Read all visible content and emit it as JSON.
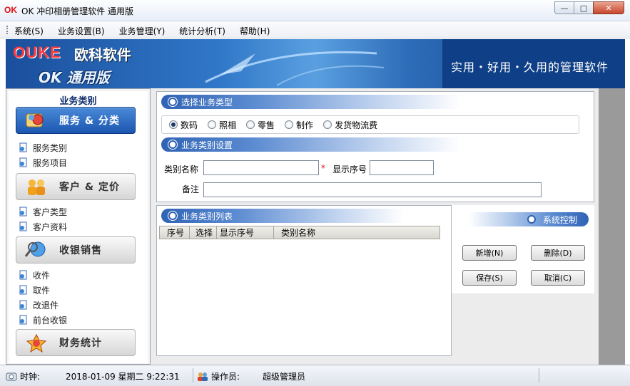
{
  "window": {
    "logo_text": "OK",
    "title": "OK 冲印相册管理软件 通用版",
    "controls": {
      "minimize": "—",
      "maximize": "□",
      "close": "✕"
    }
  },
  "menu": {
    "items": [
      {
        "label": "系统(S)"
      },
      {
        "label": "业务设置(B)"
      },
      {
        "label": "业务管理(Y)"
      },
      {
        "label": "统计分析(T)"
      },
      {
        "label": "帮助(H)"
      }
    ]
  },
  "banner": {
    "brand_en": "OUKE",
    "brand_cn": "欧科软件",
    "edition": "OK 通用版",
    "slogan": "实用・好用・久用的管理软件"
  },
  "sidebar": {
    "title": "业务类别",
    "categories": [
      {
        "label": "服务 & 分类",
        "active": true,
        "items": [
          "服务类别",
          "服务项目"
        ]
      },
      {
        "label": "客户 & 定价",
        "active": false,
        "items": [
          "客户类型",
          "客户资料"
        ]
      },
      {
        "label": "收银销售",
        "active": false,
        "items": [
          "收件",
          "取件",
          "改退件",
          "前台收银"
        ]
      },
      {
        "label": "财务统计",
        "active": false,
        "items": []
      }
    ]
  },
  "select_section": {
    "title": "选择业务类型",
    "options": [
      {
        "label": "数码",
        "selected": true
      },
      {
        "label": "照相",
        "selected": false
      },
      {
        "label": "零售",
        "selected": false
      },
      {
        "label": "制作",
        "selected": false
      },
      {
        "label": "发货物流费",
        "selected": false
      }
    ]
  },
  "settings_section": {
    "title": "业务类别设置",
    "name_label": "类别名称",
    "required_mark": "*",
    "order_label": "显示序号",
    "remark_label": "备注",
    "name_value": "",
    "order_value": "",
    "remark_value": ""
  },
  "list_section": {
    "title": "业务类别列表",
    "columns": [
      "序号",
      "选择",
      "显示序号",
      "类别名称"
    ],
    "rows": []
  },
  "control_section": {
    "title": "系统控制",
    "buttons": {
      "add": "新增(N)",
      "delete": "删除(D)",
      "save": "保存(S)",
      "cancel": "取消(C)"
    }
  },
  "status": {
    "clock_label": "时钟:",
    "datetime": "2018-01-09 星期二 9:22:31",
    "operator_label": "操作员:",
    "operator": "超级管理员"
  },
  "colors": {
    "accent": "#2f63b5",
    "banner_dark": "#0f3f86",
    "brand_red": "#ff3b3b"
  }
}
